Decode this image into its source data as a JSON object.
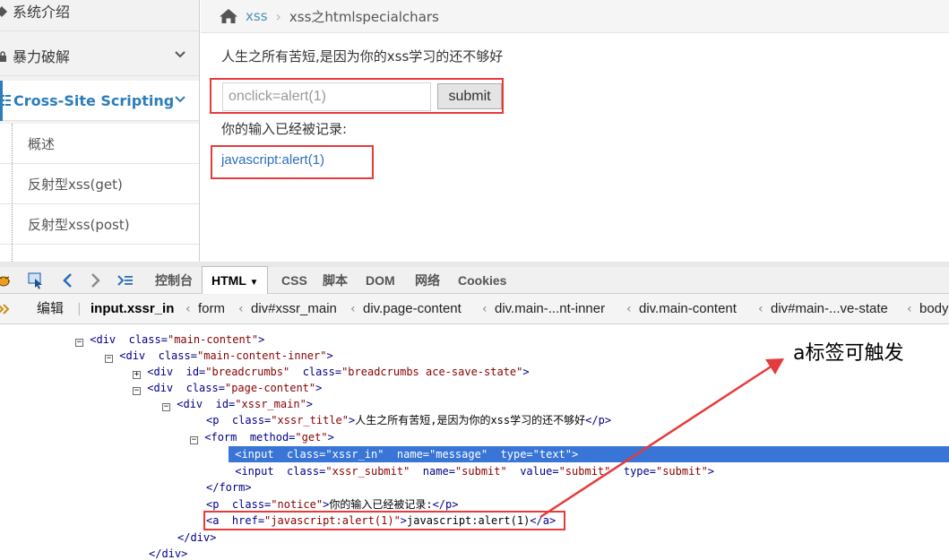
{
  "sidebar": {
    "items": [
      {
        "label": "系统介绍",
        "expanded": false
      },
      {
        "label": "暴力破解",
        "expanded": false
      },
      {
        "label": "Cross-Site Scripting",
        "expanded": true,
        "active": true
      }
    ],
    "subitems": [
      {
        "label": "概述"
      },
      {
        "label": "反射型xss(get)"
      },
      {
        "label": "反射型xss(post)"
      }
    ]
  },
  "breadcrumbs": {
    "home_icon": "home-icon",
    "link": "xss",
    "current": "xss之htmlspecialchars"
  },
  "page": {
    "title": "人生之所有苦短,是因为你的xss学习的还不够好",
    "input_value": "onclick=alert(1)",
    "submit_label": "submit",
    "notice": "你的输入已经被记录:",
    "link_text": "javascript:alert(1)",
    "link_href": "javascript:alert(1)"
  },
  "devtools": {
    "tabs": [
      "控制台",
      "HTML",
      "CSS",
      "脚本",
      "DOM",
      "网络",
      "Cookies"
    ],
    "selected_tab": "HTML",
    "edit_label": "编辑",
    "breadcrumb": [
      "input.xssr_in",
      "form",
      "div#xssr_main",
      "div.page-content",
      "div.main-...nt-inner",
      "div.main-content",
      "div#main-...ve-state",
      "body"
    ],
    "dom_lines": {
      "l1": {
        "tag": "div",
        "class": "main-content"
      },
      "l2": {
        "tag": "div",
        "class": "main-content-inner"
      },
      "l3": {
        "tag": "div",
        "id": "breadcrumbs",
        "class": "breadcrumbs ace-save-state"
      },
      "l4": {
        "tag": "div",
        "class": "page-content"
      },
      "l5": {
        "tag": "div",
        "id": "xssr_main"
      },
      "l6": {
        "tag": "p",
        "class": "xssr_title",
        "text": "人生之所有苦短,是因为你的xss学习的还不够好"
      },
      "l7": {
        "tag": "form",
        "method": "get"
      },
      "l8": {
        "tag": "input",
        "class": "xssr_in",
        "name": "message",
        "type": "text"
      },
      "l9": {
        "tag": "input",
        "class": "xssr_submit",
        "name": "submit",
        "value": "submit",
        "type": "submit"
      },
      "l10": {
        "close": "/form"
      },
      "l11": {
        "tag": "p",
        "class": "notice",
        "text": "你的输入已经被记录:"
      },
      "l12": {
        "tag": "a",
        "href": "javascript:alert(1)",
        "text": "javascript:alert(1)"
      },
      "l13": {
        "close": "/div"
      },
      "l14": {
        "close": "/div"
      }
    }
  },
  "annotation": {
    "text": "a标签可触发"
  },
  "colors": {
    "accent": "#2b7dbc",
    "highlight_box": "#e53b3b",
    "selected_row": "#3875d7"
  }
}
